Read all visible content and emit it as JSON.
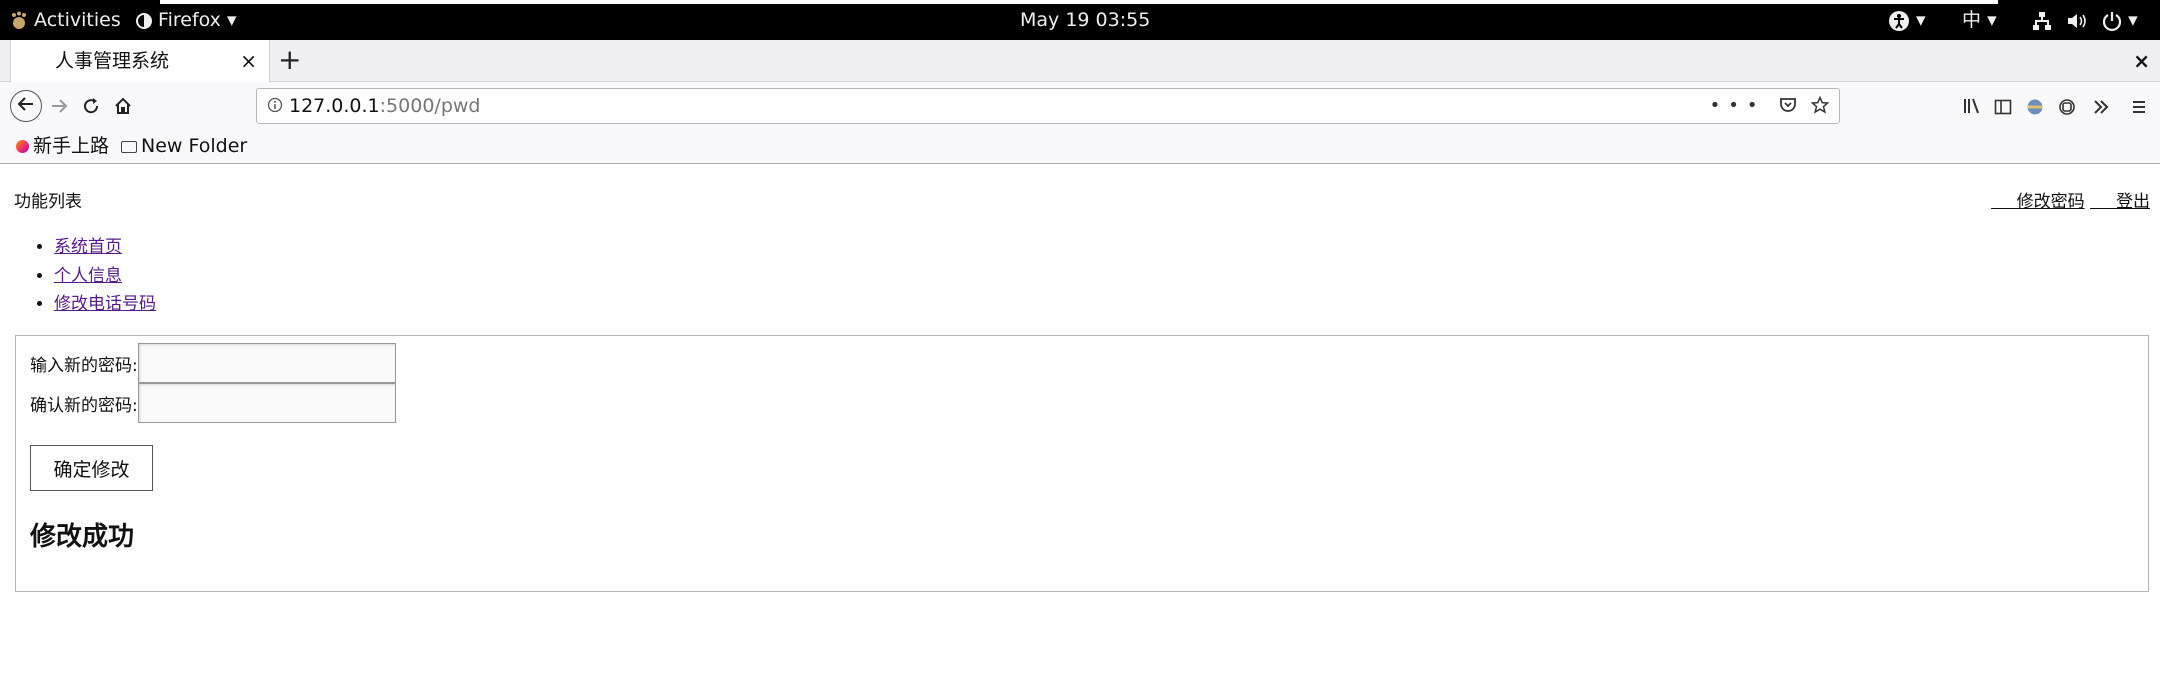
{
  "topbar": {
    "activities": "Activities",
    "app_name": "Firefox",
    "app_menu_caret": "▾",
    "clock": "May 19  03:55",
    "input_method": "中",
    "status_caret": "▾"
  },
  "browser": {
    "tab_title": "人事管理系统",
    "tab_close": "×",
    "new_tab": "+",
    "window_close": "×",
    "url_host": "127.0.0.1",
    "url_path": ":5000/pwd",
    "bookmarks": [
      {
        "label": "新手上路",
        "icon": "firefox-icon"
      },
      {
        "label": "New Folder",
        "icon": "folder-icon"
      }
    ]
  },
  "page": {
    "function_list_title": "功能列表",
    "top_links": {
      "change_password": "修改密码",
      "logout": "登出"
    },
    "menu": [
      {
        "label": "系统首页"
      },
      {
        "label": "个人信息"
      },
      {
        "label": "修改电话号码"
      }
    ],
    "form": {
      "new_password_label": "输入新的密码:",
      "confirm_password_label": "确认新的密码:",
      "new_password_value": "",
      "confirm_password_value": "",
      "submit_label": "确定修改"
    },
    "result_message": "修改成功"
  }
}
